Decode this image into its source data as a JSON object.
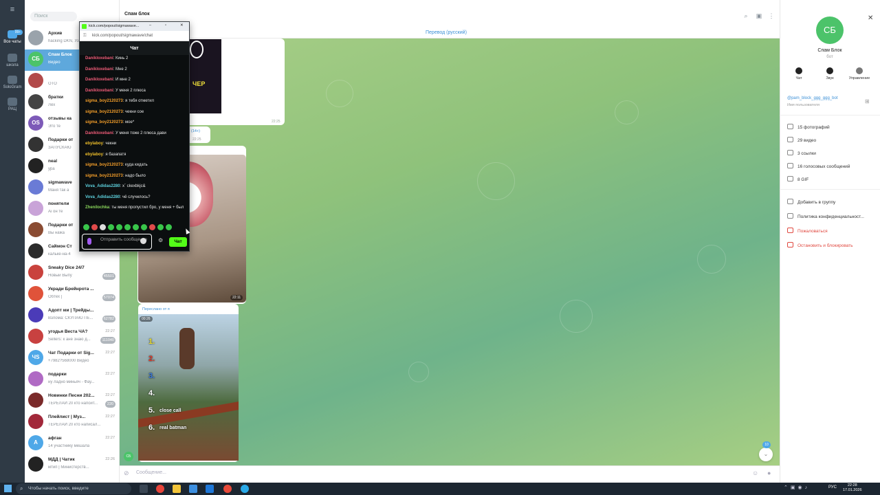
{
  "window": {
    "title": "Спам блок",
    "translate_label": "Перевод (русский)"
  },
  "rail": {
    "items": [
      {
        "label": "Все чаты",
        "badge": "99+"
      },
      {
        "label": "школа"
      },
      {
        "label": "SoloGram"
      },
      {
        "label": "РАЦ"
      }
    ]
  },
  "chatlist": {
    "search_placeholder": "Поиск",
    "chats": [
      {
        "name": "Архив",
        "preview": "hacking DKN, Уз",
        "time": "",
        "badge": "",
        "color": "#9aa3ab",
        "initials": ""
      },
      {
        "name": "Спам Блок",
        "preview": "Видео",
        "time": "",
        "badge": "",
        "color": "#4cc36a",
        "initials": "СБ"
      },
      {
        "name": "",
        "preview": "ОТО",
        "time": "",
        "badge": "",
        "color": "#b24a4a",
        "initials": ""
      },
      {
        "name": "братки",
        "preview": "Лёх",
        "time": "",
        "badge": "",
        "color": "#444",
        "initials": ""
      },
      {
        "name": "отзывы ка",
        "preview": "Это те",
        "time": "",
        "badge": "",
        "color": "#7d5ab8",
        "initials": "OS"
      },
      {
        "name": "Подарки от",
        "preview": "ЗАПУСКАЮ",
        "time": "",
        "badge": "",
        "color": "#333",
        "initials": ""
      },
      {
        "name": "neal",
        "preview": "ура",
        "time": "",
        "badge": "",
        "color": "#222",
        "initials": ""
      },
      {
        "name": "sigmawave",
        "preview": "Маня так а",
        "time": "",
        "badge": "",
        "color": "#6a7bd6",
        "initials": ""
      },
      {
        "name": "понятели",
        "preview": "Ai он те",
        "time": "",
        "badge": "",
        "color": "#c9a3d8",
        "initials": ""
      },
      {
        "name": "Подарки от",
        "preview": "Вы нажа",
        "time": "",
        "badge": "",
        "color": "#8a4b32",
        "initials": ""
      },
      {
        "name": "Саймон Ст",
        "preview": "кальке-на-4",
        "time": "",
        "badge": "",
        "color": "#2b2b2b",
        "initials": ""
      },
      {
        "name": "Sneaky Dice 24/7",
        "preview": "Новый Выпу",
        "time": "",
        "badge": "45501",
        "color": "#c9423d",
        "initials": ""
      },
      {
        "name": "Укради Брейнрота ...",
        "preview": "Обтех | ",
        "time": "",
        "badge": "57074",
        "color": "#e0533a",
        "initials": ""
      },
      {
        "name": "Адопт ми | Трейды...",
        "preview": "Взлома: СКУПАЮ ПЕ...",
        "time": "",
        "badge": "62782",
        "color": "#4b3bb8",
        "initials": ""
      },
      {
        "name": "угодья Веста ЧА?",
        "preview": "Sellers: к ане знаю д...",
        "time": "22:27",
        "badge": "111040",
        "color": "#c84140",
        "initials": ""
      },
      {
        "name": "Чат Подарки от Sig...",
        "preview": "+7982?568000  Видео",
        "time": "22:27",
        "badge": "",
        "color": "#4fa8e8",
        "initials": "ЧS"
      },
      {
        "name": "подарки",
        "preview": "ну ладно миньяч - Фау...",
        "time": "22:27",
        "badge": "",
        "color": "#b06ac4",
        "initials": ""
      },
      {
        "name": "Новинки Песни 202...",
        "preview": "ТЕРЕЛАЙ 20 кто напоит...",
        "time": "22:27",
        "badge": "220",
        "color": "#7a2a2a",
        "initials": ""
      },
      {
        "name": "Плейлист | Муз...",
        "preview": "ТЕРЕЛАЙ 20 кто написал...",
        "time": "22:27",
        "badge": "",
        "color": "#a2283a",
        "initials": ""
      },
      {
        "name": "афган",
        "preview": "14 участнику мешала",
        "time": "22:27",
        "badge": "",
        "color": "#4fa8e8",
        "initials": "A"
      },
      {
        "name": "МДД | Чатик",
        "preview": "мтип | Министерств...",
        "time": "22:26",
        "badge": "",
        "color": "#222",
        "initials": ""
      }
    ]
  },
  "header": {
    "search_icon": "search-icon",
    "menu_icon": "more-icon"
  },
  "popout": {
    "url_title": "kick.com/popout/sigmawave...",
    "url": "kick.com/popout/sigmawave/chat",
    "chat_title": "Чат",
    "messages": [
      {
        "user": "Danikloxebani",
        "text": "Кинь 2",
        "color": "#f05c78"
      },
      {
        "user": "Danikloxebani",
        "text": "Мне 2",
        "color": "#f05c78"
      },
      {
        "user": "Danikloxebani",
        "text": "И мне 2",
        "color": "#f05c78"
      },
      {
        "user": "Danikloxebani",
        "text": "У меня 2 плюса",
        "color": "#f05c78"
      },
      {
        "user": "sigma_boy2120273",
        "text": "я тебя отметил",
        "color": "#f59f2a"
      },
      {
        "user": "sigma_boy2120273",
        "text": "чекни сое",
        "color": "#f59f2a"
      },
      {
        "user": "sigma_boy2120273",
        "text": "мое*",
        "color": "#f59f2a"
      },
      {
        "user": "Danikloxebani",
        "text": "У меня тоже 2 плюса дави",
        "color": "#f05c78"
      },
      {
        "user": "ebylaboy",
        "text": "чекни",
        "color": "#f0c02a"
      },
      {
        "user": "ebylaboy",
        "text": "я базапатя",
        "color": "#f0c02a"
      },
      {
        "user": "sigma_boy2120273",
        "text": "куда кидать",
        "color": "#f59f2a"
      },
      {
        "user": "sigma_boy2120273",
        "text": "надо было",
        "color": "#f59f2a"
      },
      {
        "user": "Vova_Adidas2280",
        "text": "x` ckexbkjc&",
        "color": "#5fd4e0"
      },
      {
        "user": "Vova_Adidas2280",
        "text": "чё случилось?",
        "color": "#5fd4e0"
      },
      {
        "user": "Zhenilochka",
        "text": "ты меня пропустил бро, у меня + был",
        "color": "#8bd85c"
      }
    ],
    "input_placeholder": "Отправить сообщение",
    "send_label": "Чат"
  },
  "messages": {
    "stream_badge": "ЧЕР",
    "time1": "22:25",
    "forward_label": "(14+)",
    "time2": "22:25",
    "bird_time": "22:11",
    "forwarded_from": "Переслано от я",
    "video_duration": "00:26",
    "video_items": [
      {
        "num": "1.",
        "label": "",
        "color": "#f0e02a"
      },
      {
        "num": "2.",
        "label": "",
        "color": "#e03a2a"
      },
      {
        "num": "3.",
        "label": "",
        "color": "#3a7ae0"
      },
      {
        "num": "4.",
        "label": "",
        "color": "#ffffff"
      },
      {
        "num": "5.",
        "label": "close call",
        "color": "#ffffff"
      },
      {
        "num": "6.",
        "label": "real batman",
        "color": "#ffffff"
      }
    ],
    "sender_avatar": "СБ",
    "unread_count": "10"
  },
  "composer": {
    "placeholder": "Сообщение..."
  },
  "right_panel": {
    "avatar": "СБ",
    "name": "Спам Блок",
    "subtitle": "бот",
    "buttons": [
      "Чат",
      "Звук",
      "Управление"
    ],
    "username": "@pam_block_ggg_ggg_bot",
    "username_caption": "Имя пользователя",
    "stats": [
      "15 фотографий",
      "29 видео",
      "3 ссылки",
      "16 голосовых сообщений",
      "8 GIF"
    ],
    "actions": [
      "Добавить в группу",
      "Политика конфиденциальност...",
      "Пожаловаться",
      "Остановить и блокировать"
    ],
    "danger_color": "#e0473e"
  },
  "taskbar": {
    "search_placeholder": "Чтобы начать поиск, введите",
    "lang": "РУС",
    "time": "22:28",
    "date": "17.01.2026"
  }
}
